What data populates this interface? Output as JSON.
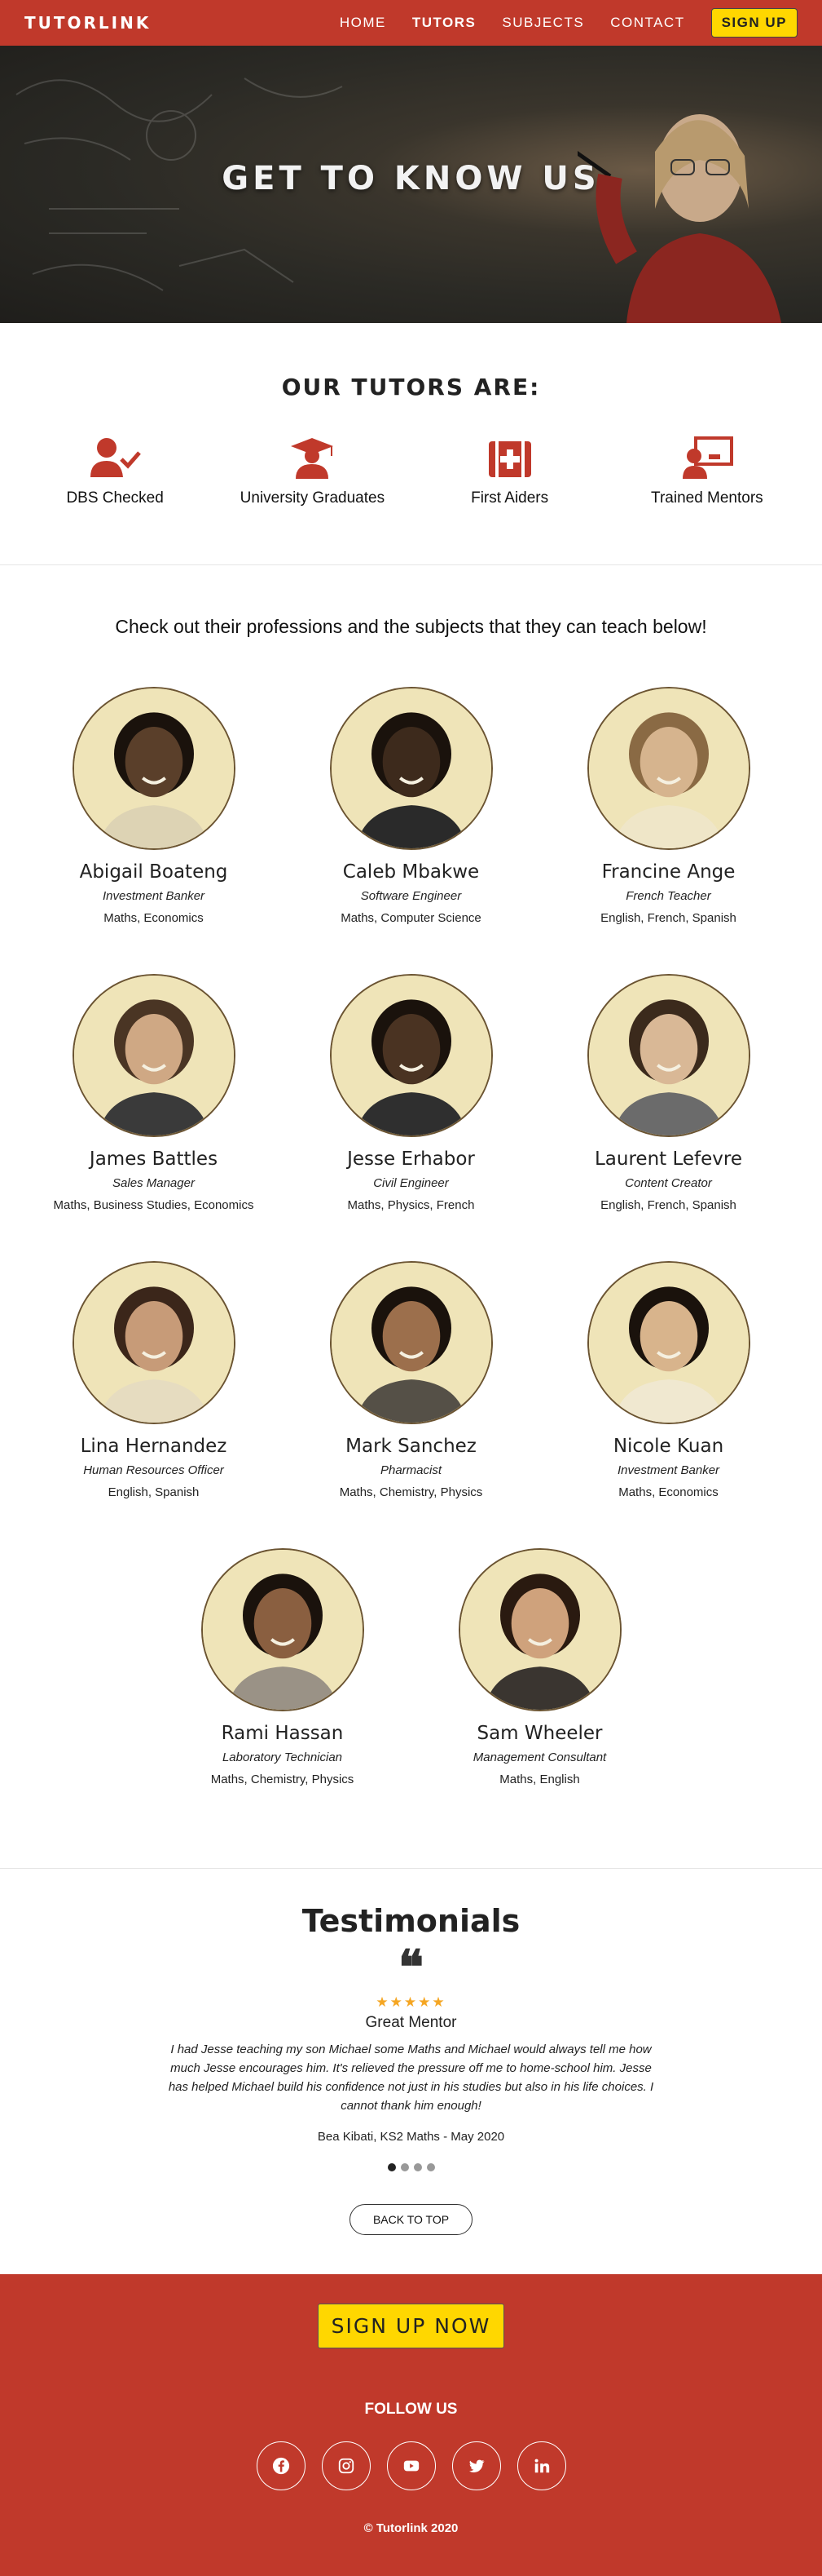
{
  "nav": {
    "logo": "TUTORLINK",
    "links": [
      "HOME",
      "TUTORS",
      "SUBJECTS",
      "CONTACT"
    ],
    "active": "TUTORS",
    "signup": "SIGN UP"
  },
  "hero": {
    "title": "GET TO KNOW US"
  },
  "qualities": {
    "heading": "OUR TUTORS ARE:",
    "items": [
      {
        "label": "DBS Checked",
        "icon": "user-check-icon"
      },
      {
        "label": "University Graduates",
        "icon": "graduate-icon"
      },
      {
        "label": "First Aiders",
        "icon": "first-aid-icon"
      },
      {
        "label": "Trained Mentors",
        "icon": "teacher-board-icon"
      }
    ]
  },
  "professions": {
    "intro": "Check out their professions and the subjects that they can teach below!",
    "tutors": [
      {
        "name": "Abigail Boateng",
        "role": "Investment Banker",
        "subjects": "Maths, Economics"
      },
      {
        "name": "Caleb Mbakwe",
        "role": "Software Engineer",
        "subjects": "Maths, Computer Science"
      },
      {
        "name": "Francine Ange",
        "role": "French Teacher",
        "subjects": "English, French, Spanish"
      },
      {
        "name": "James Battles",
        "role": "Sales Manager",
        "subjects": "Maths, Business Studies, Economics"
      },
      {
        "name": "Jesse Erhabor",
        "role": "Civil Engineer",
        "subjects": "Maths, Physics, French"
      },
      {
        "name": "Laurent Lefevre",
        "role": "Content Creator",
        "subjects": "English, French, Spanish"
      },
      {
        "name": "Lina Hernandez",
        "role": "Human Resources Officer",
        "subjects": "English, Spanish"
      },
      {
        "name": "Mark Sanchez",
        "role": "Pharmacist",
        "subjects": "Maths, Chemistry, Physics"
      },
      {
        "name": "Nicole Kuan",
        "role": "Investment Banker",
        "subjects": "Maths, Economics"
      },
      {
        "name": "Rami Hassan",
        "role": "Laboratory Technician",
        "subjects": "Maths, Chemistry, Physics"
      },
      {
        "name": "Sam Wheeler",
        "role": "Management Consultant",
        "subjects": "Maths, English"
      }
    ]
  },
  "testimonials": {
    "title": "Testimonials",
    "quote_icon": "quote-icon",
    "stars": "★★★★★",
    "heading": "Great Mentor",
    "text": "I had Jesse teaching my son Michael some Maths and Michael would always tell me how much Jesse encourages him. It's relieved the pressure off me to home-school him. Jesse has helped Michael build his confidence not just in his studies but also in his life choices. I cannot thank him enough!",
    "author": "Bea Kibati, KS2 Maths - May 2020",
    "active_slide": 1,
    "total_slides": 4
  },
  "back_to_top": "BACK TO TOP",
  "footer": {
    "signup": "SIGN UP NOW",
    "follow": "FOLLOW US",
    "socials": [
      "facebook-icon",
      "instagram-icon",
      "youtube-icon",
      "twitter-icon",
      "linkedin-icon"
    ],
    "copyright": "© Tutorlink 2020"
  },
  "colors": {
    "brand": "#c0392b",
    "accent": "#ffd700",
    "star": "#f5a623"
  }
}
